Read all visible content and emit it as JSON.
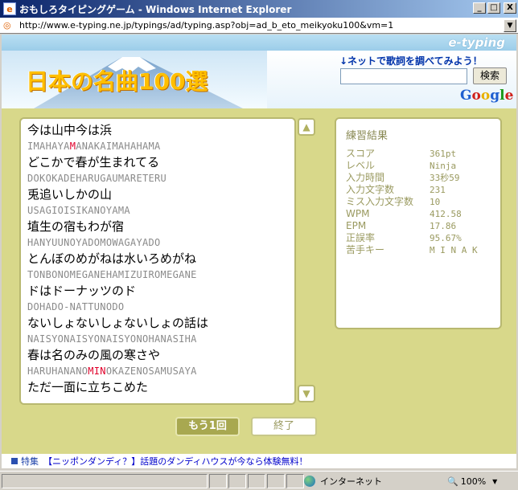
{
  "window": {
    "title": "おもしろタイピングゲーム - Windows Internet Explorer",
    "minimize": "_",
    "maximize": "□",
    "close": "X"
  },
  "address": {
    "url": "http://www.e-typing.ne.jp/typings/ad/typing.asp?obj=ad_b_eto_meikyoku100&vm=1"
  },
  "header": {
    "brand": "e-typing",
    "logo_title": "日本の名曲100選",
    "search_caption": "↓ネットで歌詞を調べてみよう！",
    "search_value": "",
    "search_button": "検索",
    "google": "Google"
  },
  "lyrics": [
    {
      "jp": "今は山中今は浜",
      "roma_before": "IMAHAYA",
      "roma_err": "M",
      "roma_after": "ANAKAIMAHAHAMA"
    },
    {
      "jp": "どこかで春が生まれてる",
      "roma_before": "DOKOKADEHARUGAUMARETERU",
      "roma_err": "",
      "roma_after": ""
    },
    {
      "jp": "兎追いしかの山",
      "roma_before": "USAGIOISIKANOYAMA",
      "roma_err": "",
      "roma_after": ""
    },
    {
      "jp": "埴生の宿もわが宿",
      "roma_before": "HANYUUNOYADOMOWAGAYADO",
      "roma_err": "",
      "roma_after": ""
    },
    {
      "jp": "とんぼのめがねは水いろめがね",
      "roma_before": "TONBONOMEGANEHAMIZUIROMEGANE",
      "roma_err": "",
      "roma_after": ""
    },
    {
      "jp": "ドはドーナッツのド",
      "roma_before": "DOHADO-NATTUNODO",
      "roma_err": "",
      "roma_after": ""
    },
    {
      "jp": "ないしょないしょないしょの話は",
      "roma_before": "NAISYONAISYONAISYONOHANASIHA",
      "roma_err": "",
      "roma_after": ""
    },
    {
      "jp": "春は名のみの風の寒さや",
      "roma_before": "HARUHANANO",
      "roma_err": "MIN",
      "roma_after": "OKAZENOSAMUSAYA"
    },
    {
      "jp": "ただ一面に立ちこめた",
      "roma_before": "",
      "roma_err": "",
      "roma_after": ""
    }
  ],
  "scroll": {
    "up": "▲",
    "down": "▼"
  },
  "results": {
    "title": "練習結果",
    "rows": [
      {
        "label": "スコア",
        "value": "361pt"
      },
      {
        "label": "レベル",
        "value": "Ninja"
      },
      {
        "label": "入力時間",
        "value": "33秒59"
      },
      {
        "label": "入力文字数",
        "value": "231"
      },
      {
        "label": "ミス入力文字数",
        "value": "10"
      },
      {
        "label": "WPM",
        "value": "412.58"
      },
      {
        "label": "EPM",
        "value": "17.86"
      },
      {
        "label": "正誤率",
        "value": "95.67%"
      },
      {
        "label": "苦手キー",
        "value": "M I N A K"
      }
    ]
  },
  "buttons": {
    "retry": "もう1回",
    "end": "終了"
  },
  "promo": {
    "tag": "特集",
    "text": "【ニッポンダンディ？】話題のダンディハウスが今なら体験無料！"
  },
  "statusbar": {
    "zone": "インターネット",
    "zoom": "100%"
  }
}
